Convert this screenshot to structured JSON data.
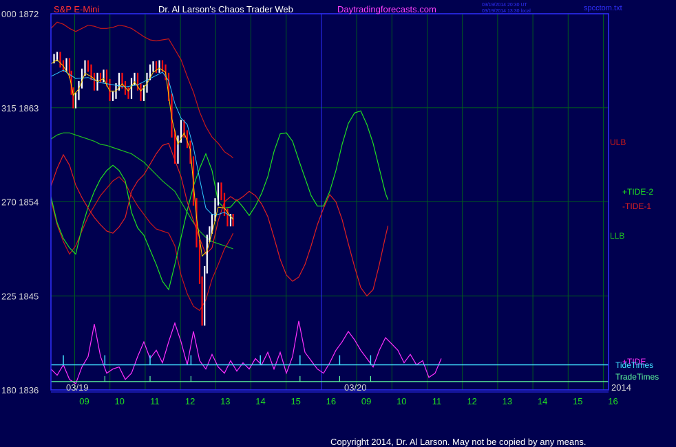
{
  "header": {
    "symbol": "S&P E-Mini",
    "author": "Dr. Al Larson's Chaos Trader Web",
    "site": "Daytradingforecasts.com",
    "stamp1": "03/19/2014 20:30 UT",
    "stamp2": "03/19/2014 13:30 local",
    "file": "spcctom.txt"
  },
  "footer": {
    "copyright": "Copyright 2014, Dr. Al Larson. May not be copied by any means."
  },
  "colors": {
    "background": "#00004f",
    "grid": "#005a1e",
    "frame": "#3030ff",
    "axis_text": "#d8d8d8",
    "price_up": "#ffffff",
    "price_down": "#ff1010",
    "ma_fast": "#ffd000",
    "ma_slow": "#30c8ff",
    "tide": "#ff30ff",
    "tide_green": "#20e020",
    "tide_red": "#e02020",
    "band_red": "#c81818",
    "band_green": "#20c020",
    "tide_times": "#40e0ff",
    "trade_times": "#60ffa0",
    "title_red": "#ff3030",
    "title_white": "#ffffff",
    "title_magenta": "#ff40ff"
  },
  "chart_data": {
    "type": "line",
    "title": "S&P E-Mini",
    "y_left_labels": [
      {
        "label": "000",
        "value": 1872
      },
      {
        "label": "315",
        "value": 1863
      },
      {
        "label": "270",
        "value": 1854
      },
      {
        "label": "225",
        "value": 1845
      },
      {
        "label": "180",
        "value": 1836
      }
    ],
    "ylim": [
      1836,
      1872
    ],
    "x_hour_labels": [
      "09",
      "10",
      "11",
      "12",
      "13",
      "14",
      "15",
      "16",
      "09",
      "10",
      "11",
      "12",
      "13",
      "14",
      "15",
      "16"
    ],
    "date_labels": [
      "03/19",
      "03/20",
      "2014"
    ],
    "right_labels": [
      "ULB",
      "+TIDE-2",
      "-TIDE-1",
      "LLB",
      "+TIDE",
      "TideTimes",
      "TradeTimes"
    ],
    "price_bars": [
      [
        0,
        1867.6
      ],
      [
        0.5,
        1867.8
      ],
      [
        1,
        1868.0
      ],
      [
        1.5,
        1867.2
      ],
      [
        2,
        1866.8
      ],
      [
        2.5,
        1867.4
      ],
      [
        3,
        1866.2
      ],
      [
        3.3,
        1864.6
      ],
      [
        3.6,
        1863.3
      ],
      [
        4,
        1864.1
      ],
      [
        4.5,
        1865.2
      ],
      [
        5,
        1866.4
      ],
      [
        5.5,
        1867.2
      ],
      [
        6,
        1866.8
      ],
      [
        6.5,
        1866.0
      ],
      [
        7,
        1865.0
      ],
      [
        7.5,
        1866.0
      ],
      [
        8,
        1865.8
      ],
      [
        8.5,
        1866.3
      ],
      [
        9,
        1865.4
      ],
      [
        9.5,
        1864.0
      ],
      [
        10,
        1864.2
      ],
      [
        10.5,
        1865.0
      ],
      [
        11,
        1866.0
      ],
      [
        11.5,
        1865.2
      ],
      [
        12,
        1864.6
      ],
      [
        12.5,
        1864.2
      ],
      [
        13,
        1865.5
      ],
      [
        13.5,
        1866.0
      ],
      [
        14,
        1865.0
      ],
      [
        14.5,
        1864.0
      ],
      [
        15,
        1864.8
      ],
      [
        15.5,
        1866.0
      ],
      [
        16,
        1866.8
      ],
      [
        16.5,
        1867.1
      ],
      [
        17,
        1866.7
      ],
      [
        17.5,
        1867.2
      ],
      [
        18,
        1866.8
      ],
      [
        18.5,
        1866.0
      ],
      [
        19,
        1864.0
      ],
      [
        19.5,
        1860.5
      ],
      [
        20,
        1858.0
      ],
      [
        20.5,
        1860.0
      ],
      [
        21,
        1861.5
      ],
      [
        21.5,
        1860.5
      ],
      [
        22,
        1859.5
      ],
      [
        22.5,
        1858.0
      ],
      [
        23,
        1854.0
      ],
      [
        23.5,
        1850.0
      ],
      [
        24,
        1846.5
      ],
      [
        24.4,
        1842.5
      ],
      [
        24.8,
        1847.5
      ],
      [
        25.2,
        1850.5
      ],
      [
        25.6,
        1851.3
      ],
      [
        26,
        1852.5
      ],
      [
        26.5,
        1854.0
      ],
      [
        27,
        1855.5
      ],
      [
        27.5,
        1854.5
      ],
      [
        28,
        1853.0
      ],
      [
        28.5,
        1852.0
      ],
      [
        29,
        1852.5
      ],
      [
        29.4,
        1852.0
      ]
    ],
    "ma_fast": [
      [
        0,
        1867.2
      ],
      [
        1,
        1867.6
      ],
      [
        2,
        1867.0
      ],
      [
        3,
        1866.0
      ],
      [
        3.6,
        1864.2
      ],
      [
        4.5,
        1864.8
      ],
      [
        5.5,
        1866.3
      ],
      [
        6.5,
        1866.0
      ],
      [
        7.5,
        1865.5
      ],
      [
        8.5,
        1865.8
      ],
      [
        9.5,
        1864.6
      ],
      [
        10.5,
        1864.6
      ],
      [
        11.5,
        1865.3
      ],
      [
        12.5,
        1864.6
      ],
      [
        13.5,
        1865.5
      ],
      [
        14.5,
        1864.6
      ],
      [
        15.5,
        1865.3
      ],
      [
        16.5,
        1866.4
      ],
      [
        17.5,
        1866.8
      ],
      [
        18.5,
        1866.4
      ],
      [
        19.5,
        1862.0
      ],
      [
        20.5,
        1859.5
      ],
      [
        21.5,
        1860.6
      ],
      [
        22.5,
        1859.0
      ],
      [
        23.5,
        1852.5
      ],
      [
        24.4,
        1848.8
      ],
      [
        25.2,
        1849.3
      ],
      [
        26,
        1851.0
      ],
      [
        27,
        1853.5
      ],
      [
        28,
        1853.4
      ],
      [
        29,
        1852.6
      ],
      [
        29.4,
        1852.3
      ]
    ],
    "ma_slow": [
      [
        0,
        1866.0
      ],
      [
        2,
        1866.6
      ],
      [
        4,
        1865.8
      ],
      [
        6,
        1865.9
      ],
      [
        8,
        1865.4
      ],
      [
        10,
        1865.2
      ],
      [
        12,
        1865.0
      ],
      [
        14,
        1865.2
      ],
      [
        16,
        1865.8
      ],
      [
        18,
        1866.4
      ],
      [
        19,
        1865.6
      ],
      [
        20,
        1863.4
      ],
      [
        21,
        1862.0
      ],
      [
        22,
        1861.4
      ],
      [
        23,
        1859.2
      ],
      [
        24,
        1856.2
      ],
      [
        25,
        1853.4
      ],
      [
        26,
        1852.8
      ],
      [
        27,
        1852.8
      ],
      [
        28,
        1853.0
      ],
      [
        29,
        1852.6
      ],
      [
        29.4,
        1852.4
      ]
    ],
    "ulb": [
      [
        0,
        1870.6
      ],
      [
        1,
        1871.2
      ],
      [
        2,
        1871.0
      ],
      [
        3,
        1870.6
      ],
      [
        4,
        1870.3
      ],
      [
        5,
        1870.6
      ],
      [
        6,
        1870.9
      ],
      [
        7,
        1870.8
      ],
      [
        8,
        1870.6
      ],
      [
        9,
        1870.6
      ],
      [
        10,
        1870.7
      ],
      [
        11,
        1870.9
      ],
      [
        12,
        1870.8
      ],
      [
        13,
        1870.6
      ],
      [
        14,
        1870.2
      ],
      [
        15,
        1869.8
      ],
      [
        16,
        1869.5
      ],
      [
        17,
        1869.4
      ],
      [
        18,
        1869.5
      ],
      [
        19,
        1869.6
      ],
      [
        20,
        1868.6
      ],
      [
        21,
        1867.6
      ],
      [
        22,
        1866.0
      ],
      [
        23,
        1864.5
      ],
      [
        24,
        1862.6
      ],
      [
        25,
        1861.2
      ],
      [
        26,
        1860.2
      ],
      [
        27,
        1859.6
      ],
      [
        28,
        1858.8
      ],
      [
        29,
        1858.4
      ],
      [
        29.4,
        1858.2
      ]
    ],
    "mid_band": [
      [
        0,
        1860.0
      ],
      [
        1,
        1860.4
      ],
      [
        2,
        1860.6
      ],
      [
        3,
        1860.6
      ],
      [
        4,
        1860.4
      ],
      [
        5,
        1860.2
      ],
      [
        6,
        1860.0
      ],
      [
        7,
        1859.8
      ],
      [
        8,
        1859.5
      ],
      [
        9,
        1859.4
      ],
      [
        10,
        1859.2
      ],
      [
        11,
        1859.0
      ],
      [
        12,
        1858.8
      ],
      [
        13,
        1858.6
      ],
      [
        14,
        1858.2
      ],
      [
        15,
        1857.8
      ],
      [
        16,
        1857.2
      ],
      [
        17,
        1856.6
      ],
      [
        18,
        1856.0
      ],
      [
        19,
        1855.5
      ],
      [
        20,
        1855.0
      ],
      [
        21,
        1854.0
      ],
      [
        22,
        1853.0
      ],
      [
        23,
        1852.0
      ],
      [
        24,
        1851.2
      ],
      [
        25,
        1850.6
      ],
      [
        26,
        1850.2
      ],
      [
        27,
        1850.0
      ],
      [
        28,
        1849.8
      ],
      [
        29,
        1849.6
      ],
      [
        29.4,
        1849.5
      ]
    ],
    "llb": [
      [
        0,
        1854.2
      ],
      [
        1,
        1851.8
      ],
      [
        2,
        1850.2
      ],
      [
        3,
        1849.0
      ],
      [
        4,
        1849.8
      ],
      [
        5,
        1851.2
      ],
      [
        6,
        1852.6
      ],
      [
        7,
        1853.6
      ],
      [
        8,
        1854.6
      ],
      [
        9,
        1855.3
      ],
      [
        10,
        1856.0
      ],
      [
        11,
        1856.4
      ],
      [
        12,
        1855.8
      ],
      [
        13,
        1854.6
      ],
      [
        14,
        1853.6
      ],
      [
        15,
        1852.8
      ],
      [
        16,
        1852.0
      ],
      [
        17,
        1851.4
      ],
      [
        18,
        1851.2
      ],
      [
        19,
        1851.0
      ],
      [
        20,
        1849.8
      ],
      [
        21,
        1847.0
      ],
      [
        22,
        1845.2
      ],
      [
        23,
        1844.0
      ],
      [
        24,
        1843.6
      ],
      [
        25,
        1844.6
      ],
      [
        26,
        1846.6
      ],
      [
        27,
        1848.0
      ],
      [
        28,
        1849.5
      ],
      [
        29,
        1850.5
      ],
      [
        29.4,
        1851.0
      ]
    ],
    "tide_plus2": [
      [
        0,
        1854.5
      ],
      [
        1,
        1852.0
      ],
      [
        2,
        1850.5
      ],
      [
        3,
        1849.6
      ],
      [
        4,
        1849.0
      ],
      [
        5,
        1851.5
      ],
      [
        6,
        1853.5
      ],
      [
        7,
        1855.0
      ],
      [
        8,
        1856.2
      ],
      [
        9,
        1857.0
      ],
      [
        10,
        1857.5
      ],
      [
        11,
        1857.0
      ],
      [
        12,
        1856.0
      ],
      [
        13,
        1853.0
      ],
      [
        14,
        1851.5
      ],
      [
        15,
        1850.8
      ],
      [
        16,
        1849.4
      ],
      [
        17,
        1848.0
      ],
      [
        18,
        1846.4
      ],
      [
        19,
        1845.6
      ],
      [
        20,
        1848.0
      ],
      [
        21,
        1850.6
      ],
      [
        22,
        1853.2
      ],
      [
        23,
        1855.5
      ],
      [
        24,
        1857.2
      ],
      [
        25,
        1858.6
      ],
      [
        26,
        1857.0
      ],
      [
        27,
        1854.0
      ],
      [
        28,
        1853.4
      ],
      [
        29,
        1853.5
      ],
      [
        30,
        1854.2
      ],
      [
        31,
        1853.5
      ],
      [
        32,
        1852.7
      ],
      [
        33,
        1853.6
      ],
      [
        34,
        1854.8
      ],
      [
        35,
        1856.4
      ],
      [
        36,
        1858.8
      ],
      [
        37,
        1860.5
      ],
      [
        38,
        1860.6
      ],
      [
        39,
        1859.8
      ],
      [
        40,
        1858.0
      ],
      [
        41,
        1856.3
      ],
      [
        42,
        1854.6
      ],
      [
        43,
        1853.6
      ],
      [
        44,
        1853.6
      ],
      [
        45,
        1855.0
      ],
      [
        46,
        1857.0
      ],
      [
        47,
        1859.5
      ],
      [
        48,
        1861.5
      ],
      [
        49,
        1862.5
      ],
      [
        50,
        1862.7
      ],
      [
        51,
        1861.4
      ],
      [
        52,
        1859.6
      ],
      [
        53,
        1857.2
      ],
      [
        54,
        1854.8
      ],
      [
        54.4,
        1854.2
      ]
    ],
    "tide_minus1": [
      [
        0,
        1855.5
      ],
      [
        1,
        1857.2
      ],
      [
        2,
        1858.5
      ],
      [
        3,
        1857.5
      ],
      [
        4,
        1855.6
      ],
      [
        5,
        1854.4
      ],
      [
        6,
        1853.4
      ],
      [
        7,
        1852.5
      ],
      [
        8,
        1851.8
      ],
      [
        9,
        1851.2
      ],
      [
        10,
        1851.0
      ],
      [
        11,
        1851.6
      ],
      [
        12,
        1852.5
      ],
      [
        13,
        1855.0
      ],
      [
        14,
        1856.0
      ],
      [
        15,
        1856.6
      ],
      [
        16,
        1857.6
      ],
      [
        17,
        1858.6
      ],
      [
        18,
        1859.4
      ],
      [
        19,
        1859.6
      ],
      [
        20,
        1858.0
      ],
      [
        21,
        1856.4
      ],
      [
        22,
        1854.0
      ],
      [
        23,
        1852.2
      ],
      [
        24,
        1850.5
      ],
      [
        25,
        1849.0
      ],
      [
        26,
        1849.6
      ],
      [
        27,
        1852.2
      ],
      [
        28,
        1854.0
      ],
      [
        29,
        1854.5
      ],
      [
        30,
        1854.1
      ],
      [
        31,
        1854.5
      ],
      [
        32,
        1855.0
      ],
      [
        33,
        1854.6
      ],
      [
        34,
        1853.8
      ],
      [
        35,
        1852.6
      ],
      [
        36,
        1850.6
      ],
      [
        37,
        1848.5
      ],
      [
        38,
        1847.0
      ],
      [
        39,
        1846.4
      ],
      [
        40,
        1846.8
      ],
      [
        41,
        1848.0
      ],
      [
        42,
        1849.8
      ],
      [
        43,
        1851.8
      ],
      [
        44,
        1853.4
      ],
      [
        45,
        1854.7
      ],
      [
        46,
        1854.0
      ],
      [
        47,
        1852.3
      ],
      [
        48,
        1850.0
      ],
      [
        49,
        1847.8
      ],
      [
        50,
        1845.8
      ],
      [
        51,
        1845.0
      ],
      [
        52,
        1845.6
      ],
      [
        53,
        1848.0
      ],
      [
        54,
        1850.7
      ],
      [
        54.4,
        1851.7
      ]
    ],
    "tide_osc": [
      [
        0,
        1838.0
      ],
      [
        1,
        1837.4
      ],
      [
        2,
        1838.4
      ],
      [
        3,
        1837.0
      ],
      [
        4,
        1836.6
      ],
      [
        5,
        1838.2
      ],
      [
        6,
        1839.2
      ],
      [
        7,
        1842.3
      ],
      [
        8,
        1839.2
      ],
      [
        9,
        1837.6
      ],
      [
        10,
        1838.0
      ],
      [
        11,
        1838.2
      ],
      [
        12,
        1837.0
      ],
      [
        13,
        1837.6
      ],
      [
        14,
        1839.2
      ],
      [
        15,
        1840.6
      ],
      [
        16,
        1839.0
      ],
      [
        17,
        1839.8
      ],
      [
        18,
        1838.6
      ],
      [
        19,
        1840.6
      ],
      [
        20,
        1842.4
      ],
      [
        21,
        1840.6
      ],
      [
        22,
        1838.4
      ],
      [
        23,
        1841.6
      ],
      [
        24,
        1838.8
      ],
      [
        25,
        1838.0
      ],
      [
        26,
        1839.4
      ],
      [
        27,
        1838.2
      ],
      [
        28,
        1837.6
      ],
      [
        29,
        1838.8
      ],
      [
        30,
        1837.8
      ],
      [
        31,
        1838.6
      ],
      [
        32,
        1838.0
      ],
      [
        33,
        1839.0
      ],
      [
        34,
        1838.4
      ],
      [
        35,
        1839.6
      ],
      [
        36,
        1838.0
      ],
      [
        37,
        1839.6
      ],
      [
        38,
        1837.6
      ],
      [
        39,
        1839.2
      ],
      [
        40,
        1842.6
      ],
      [
        41,
        1839.6
      ],
      [
        42,
        1838.8
      ],
      [
        43,
        1838.0
      ],
      [
        44,
        1837.6
      ],
      [
        45,
        1838.6
      ],
      [
        46,
        1839.8
      ],
      [
        47,
        1840.6
      ],
      [
        48,
        1841.6
      ],
      [
        49,
        1840.8
      ],
      [
        50,
        1839.8
      ],
      [
        51,
        1839.0
      ],
      [
        52,
        1838.2
      ],
      [
        53,
        1839.8
      ],
      [
        54,
        1841.0
      ],
      [
        55,
        1840.4
      ],
      [
        56,
        1839.8
      ],
      [
        57,
        1838.6
      ],
      [
        58,
        1839.4
      ],
      [
        59,
        1838.4
      ],
      [
        60,
        1838.8
      ],
      [
        61,
        1837.2
      ],
      [
        62,
        1837.6
      ],
      [
        63,
        1839.0
      ]
    ],
    "tide_times": [
      2,
      8.7,
      16,
      22.6,
      33.8,
      40.2,
      46.6,
      51.6
    ],
    "trade_times": [
      8.7,
      16,
      22.6,
      40.2,
      46.6,
      51.6
    ]
  }
}
